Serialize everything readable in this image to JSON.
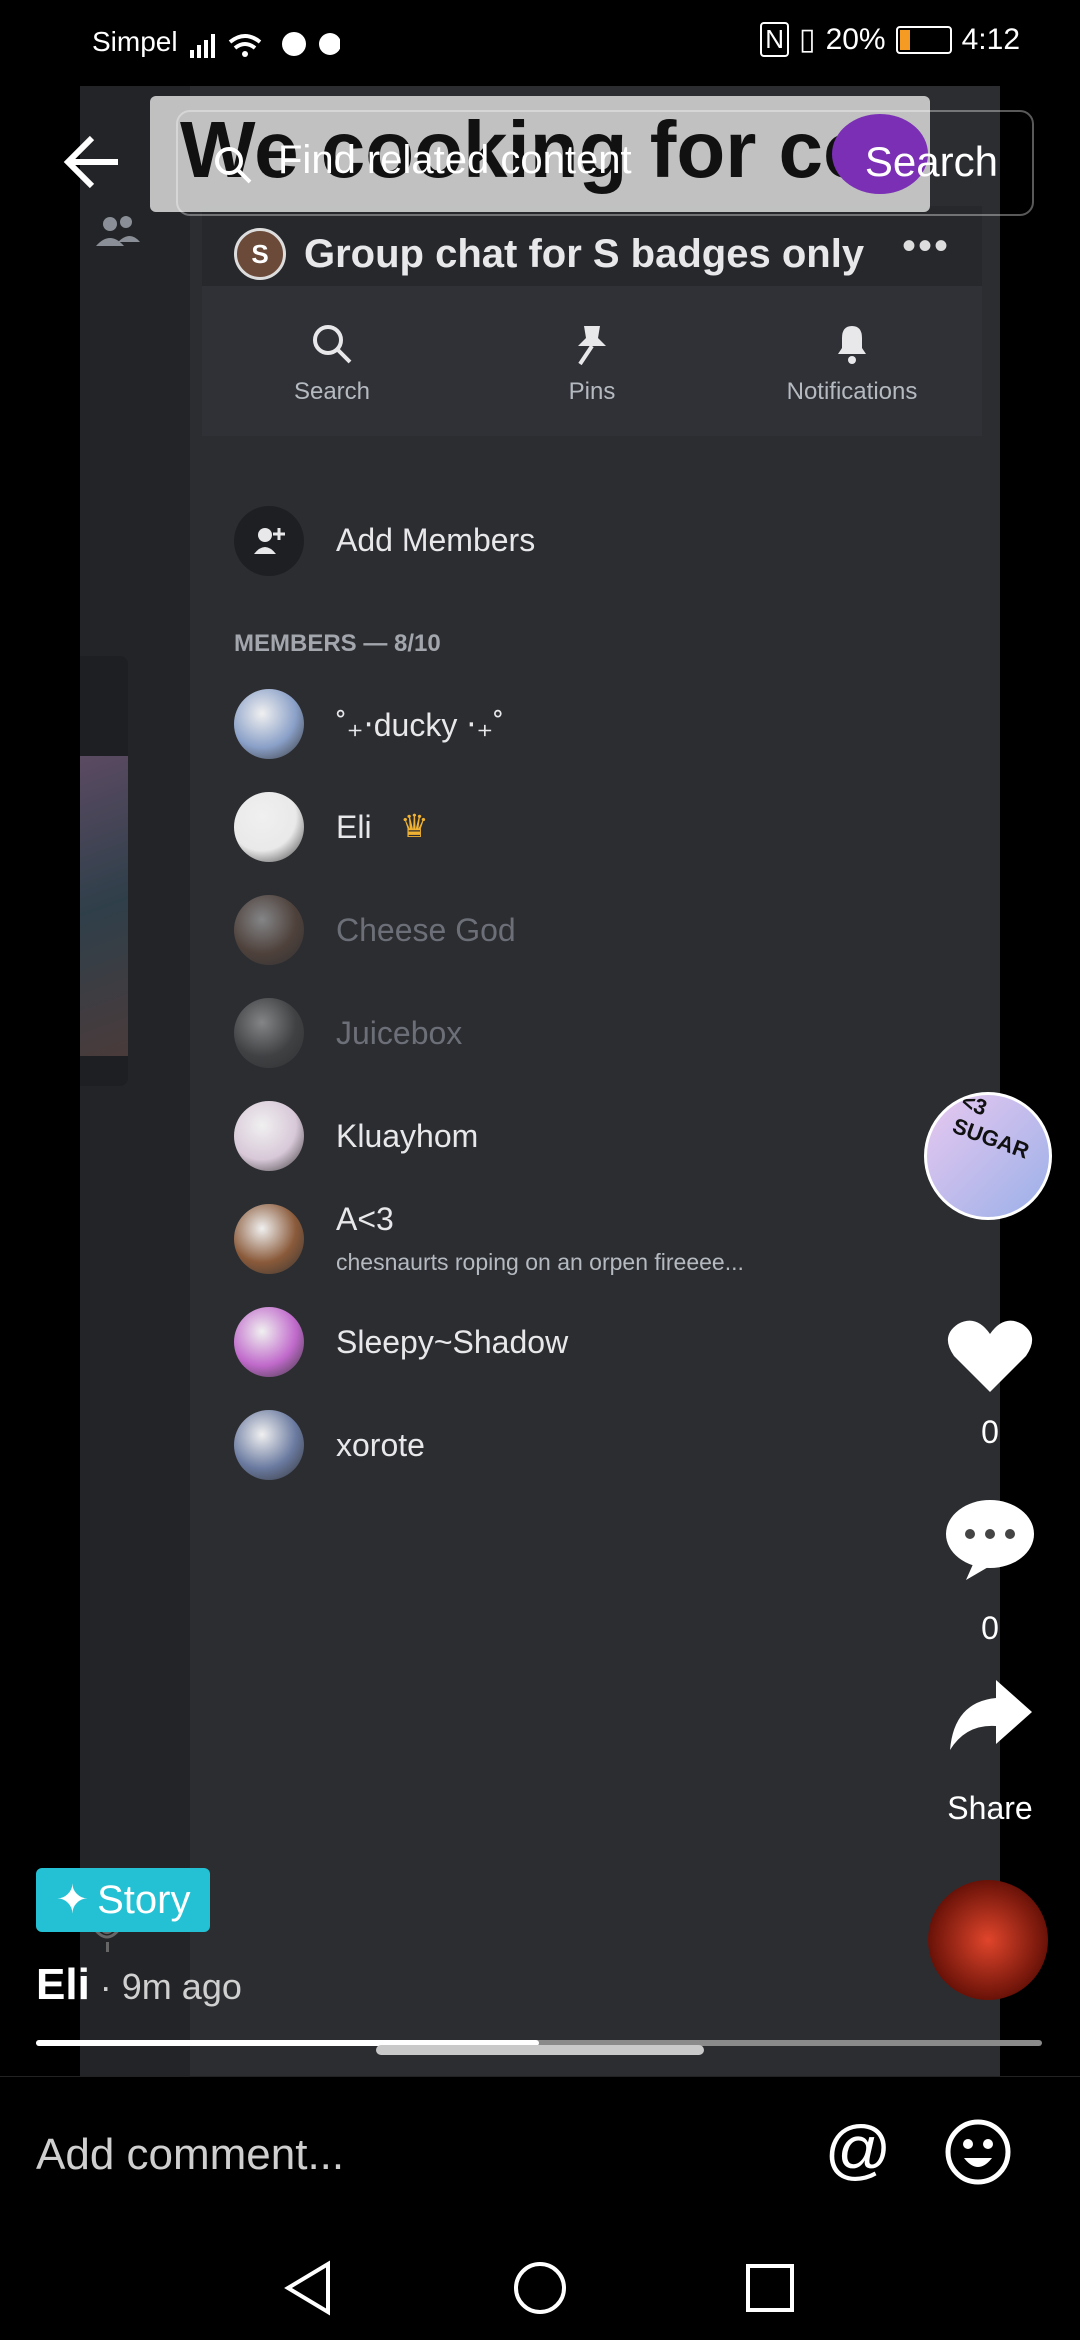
{
  "status_bar": {
    "carrier": "Simpel",
    "battery_text": "20%",
    "battery_level": 0.2,
    "time": "4:12"
  },
  "overlay": {
    "video_title": "We cooking for coa",
    "search_placeholder": "Find related content",
    "search_button": "Search"
  },
  "discord": {
    "group_title": "Group chat for S badges only",
    "group_avatar_letter": "S",
    "tools": [
      {
        "label": "Search",
        "icon": "search-icon"
      },
      {
        "label": "Pins",
        "icon": "pin-icon"
      },
      {
        "label": "Notifications",
        "icon": "bell-icon"
      }
    ],
    "add_members": "Add Members",
    "members_header": "MEMBERS — 8/10",
    "members": [
      {
        "name": "˚₊‧ducky ‧₊˚",
        "status": "",
        "dim": false,
        "color": "#8aa0c8"
      },
      {
        "name": "Eli",
        "status": "",
        "dim": false,
        "color": "#e9e9e9",
        "crown": true
      },
      {
        "name": "Cheese God",
        "status": "",
        "dim": true,
        "color": "#7a5a48"
      },
      {
        "name": "Juicebox",
        "status": "",
        "dim": true,
        "color": "#5a5a5a"
      },
      {
        "name": "Kluayhom",
        "status": "",
        "dim": false,
        "color": "#d8c8d8"
      },
      {
        "name": "A<3",
        "status": "chesnaurts roping on an orpen fireeee...",
        "dim": false,
        "color": "#8a5a3a"
      },
      {
        "name": "Sleepy~Shadow",
        "status": "",
        "dim": false,
        "color": "#c06acb"
      },
      {
        "name": "xorote",
        "status": "",
        "dim": false,
        "color": "#6a7aa0"
      }
    ]
  },
  "rail": {
    "likes": "0",
    "comments": "0",
    "share_label": "Share",
    "badge_text": "<3 SUGAR"
  },
  "post": {
    "story_label": "Story",
    "author": "Eli",
    "time": " · 9m ago",
    "progress": 0.5
  },
  "comment_bar": {
    "placeholder": "Add comment..."
  }
}
